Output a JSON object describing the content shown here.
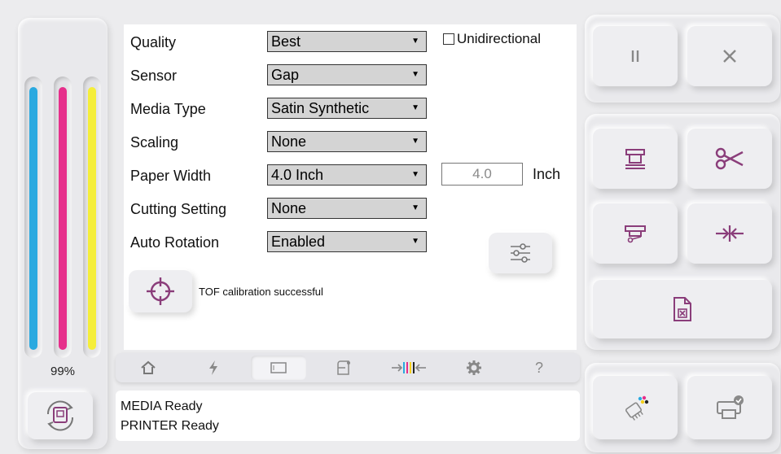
{
  "ink": {
    "percent": "99%",
    "levels": [
      {
        "name": "cyan",
        "color": "#2aa9e0",
        "fraction": 0.99
      },
      {
        "name": "magenta",
        "color": "#e62f8b",
        "fraction": 0.99
      },
      {
        "name": "yellow",
        "color": "#f5ee3a",
        "fraction": 0.99
      }
    ]
  },
  "settings": {
    "quality": {
      "label": "Quality",
      "value": "Best"
    },
    "sensor": {
      "label": "Sensor",
      "value": "Gap"
    },
    "media_type": {
      "label": "Media Type",
      "value": "Satin Synthetic"
    },
    "scaling": {
      "label": "Scaling",
      "value": "None"
    },
    "paper_width": {
      "label": "Paper Width",
      "value": "4.0 Inch",
      "input_value": "4.0",
      "unit": "Inch"
    },
    "cutting": {
      "label": "Cutting Setting",
      "value": "None"
    },
    "rotation": {
      "label": "Auto Rotation",
      "value": "Enabled"
    },
    "unidirectional": {
      "label": "Unidirectional",
      "checked": false
    },
    "dropdown_arrow": "▼",
    "tof_message": "TOF calibration successful"
  },
  "tabs": [
    "home-icon",
    "bolt-icon",
    "media-icon",
    "paper-icon",
    "calibration-icon",
    "gear-icon",
    "help-icon"
  ],
  "tab_help": "?",
  "status": {
    "line1": "MEDIA Ready",
    "line2": "PRINTER Ready"
  },
  "accent": "#8a3d7a"
}
